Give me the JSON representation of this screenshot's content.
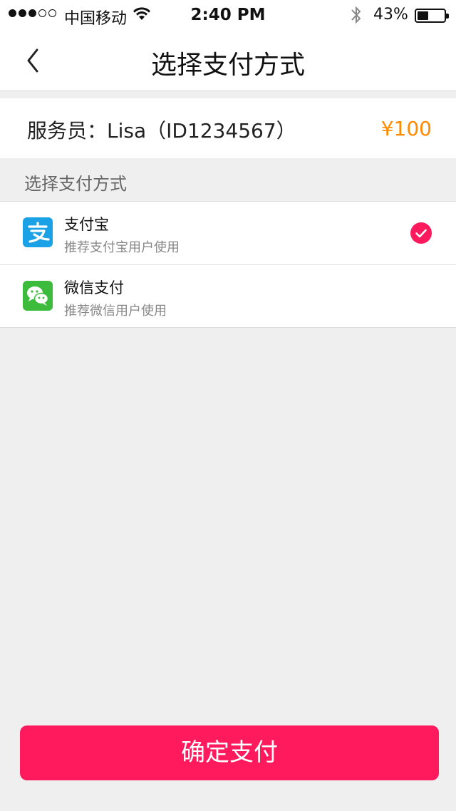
{
  "status_bar": {
    "carrier": "中国移动",
    "time": "2:40 PM",
    "battery": "43%",
    "battery_level": 0.43,
    "signal_bars_filled": 3,
    "signal_bars_total": 5,
    "icons": [
      "wifi-icon",
      "bluetooth-icon",
      "battery-icon"
    ]
  },
  "nav": {
    "title": "选择支付方式",
    "back_icon": "chevron-left-icon"
  },
  "order": {
    "staff": "服务员：Lisa（ID1234567）",
    "price": "¥100"
  },
  "section_label": "选择支付方式",
  "payment_methods": [
    {
      "name": "支付宝",
      "description": "推荐支付宝用户使用",
      "icon": "alipay-icon",
      "selected": true
    },
    {
      "name": "微信支付",
      "description": "推荐微信用户使用",
      "icon": "wechat-icon",
      "selected": false
    }
  ],
  "confirm_label": "确定支付",
  "colors": {
    "accent": "#ff1a5e",
    "price": "#ff8a00",
    "alipay": "#1aa1e6",
    "wechat": "#3dbb3d",
    "background": "#efefef"
  }
}
